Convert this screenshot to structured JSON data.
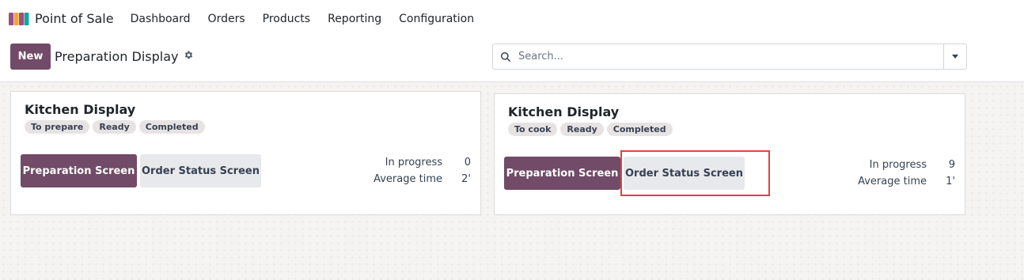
{
  "navbar": {
    "app_name": "Point of Sale",
    "menu": [
      {
        "label": "Dashboard"
      },
      {
        "label": "Orders"
      },
      {
        "label": "Products"
      },
      {
        "label": "Reporting"
      },
      {
        "label": "Configuration"
      }
    ]
  },
  "control_panel": {
    "new_label": "New",
    "title": "Preparation Display",
    "search_placeholder": "Search..."
  },
  "cards": [
    {
      "title": "Kitchen Display",
      "tags": [
        "To prepare",
        "Ready",
        "Completed"
      ],
      "primary_button": "Preparation Screen",
      "secondary_button": "Order Status Screen",
      "stats": [
        {
          "label": "In progress",
          "value": "0"
        },
        {
          "label": "Average time",
          "value": "2'"
        }
      ]
    },
    {
      "title": "Kitchen Display",
      "tags": [
        "To cook",
        "Ready",
        "Completed"
      ],
      "primary_button": "Preparation Screen",
      "secondary_button": "Order Status Screen",
      "stats": [
        {
          "label": "In progress",
          "value": "9"
        },
        {
          "label": "Average time",
          "value": "1'"
        }
      ]
    }
  ],
  "colors": {
    "brand": "#714b67",
    "highlight": "#e0443a"
  },
  "icons": {
    "app": "pos-awning-icon",
    "settings": "gear-icon",
    "search": "search-icon",
    "toggle": "caret-down-icon"
  }
}
